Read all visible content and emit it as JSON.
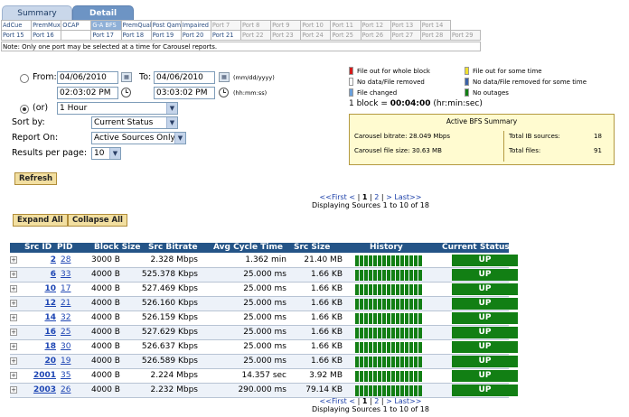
{
  "tabs": [
    {
      "label": "Summary",
      "active": false
    },
    {
      "label": "Detail",
      "active": true
    }
  ],
  "ports": {
    "row1": [
      "AdCue",
      "PremMux1",
      "OCAP",
      "G-A BFS",
      "PremQual",
      "Post Qam",
      "Impaired",
      "Port 7",
      "Port 8",
      "Port 9",
      "Port 10",
      "Port 11",
      "Port 12",
      "Port 13",
      "Port 14"
    ],
    "row2": [
      "Port 15",
      "Port 16",
      "",
      "Port 17",
      "Port 18",
      "Port 19",
      "Port 20",
      "Port 21",
      "Port 22",
      "Port 23",
      "Port 24",
      "Port 25",
      "Port 26",
      "Port 27",
      "Port 28",
      "Port 29"
    ],
    "selected": "G-A BFS",
    "note": "Note: Only one port may be selected at a time for Carousel reports."
  },
  "form": {
    "from_label": "From:",
    "from_date": "04/06/2010",
    "from_time": "02:03:02 PM",
    "to_label": "To:",
    "to_date": "04/06/2010",
    "to_time": "03:03:02 PM",
    "date_format": "(mm/dd/yyyy)",
    "time_format": "(hh:mm:ss)",
    "or_label": "(or)",
    "range_value": "1 Hour",
    "sort_label": "Sort by:",
    "sort_value": "Current Status",
    "report_label": "Report On:",
    "report_value": "Active Sources Only",
    "rpp_label": "Results per page:",
    "rpp_value": "10",
    "refresh_label": "Refresh"
  },
  "legend": {
    "items": [
      {
        "color": "#d61b1b",
        "label": "File out for whole block"
      },
      {
        "color": "#f0e030",
        "label": "File out for some time"
      },
      {
        "color": "#ffffff",
        "label": "No data/File removed"
      },
      {
        "color": "#3a62a8",
        "label": "No data/File removed for some time"
      },
      {
        "color": "#6aa0dc",
        "label": "File changed"
      },
      {
        "color": "#127f14",
        "label": "No outages"
      }
    ],
    "block_prefix": "1 block = ",
    "block_value": "00:04:00",
    "block_suffix": " (hr:min:sec)"
  },
  "summary": {
    "title": "Active BFS Summary",
    "bitrate_label": "Carousel bitrate:",
    "bitrate_value": "28.049 Mbps",
    "filesize_label": "Carousel file size:",
    "filesize_value": "30.63 MB",
    "sources_label": "Total IB sources:",
    "sources_value": "18",
    "files_label": "Total files:",
    "files_value": "91"
  },
  "pagination": {
    "first": "<<First",
    "prev": "<",
    "sep": "|",
    "page1": "1",
    "page2": "2",
    "next": ">",
    "last": "Last>>",
    "info": "Displaying Sources 1 to 10 of 18"
  },
  "buttons": {
    "expand_all": "Expand All",
    "collapse_all": "Collapse All"
  },
  "table": {
    "headers": [
      "Src ID",
      "PID",
      "Block Size",
      "Src Bitrate",
      "Avg Cycle Time",
      "Src Size",
      "History",
      "Current Status"
    ],
    "rows": [
      {
        "src_id": "2",
        "pid": "28",
        "block_size": "3000 B",
        "bitrate": "2.328 Mbps",
        "cycle": "1.362 min",
        "size": "21.40 MB",
        "status": "UP"
      },
      {
        "src_id": "6",
        "pid": "33",
        "block_size": "4000 B",
        "bitrate": "525.378 Kbps",
        "cycle": "25.000 ms",
        "size": "1.66 KB",
        "status": "UP"
      },
      {
        "src_id": "10",
        "pid": "17",
        "block_size": "4000 B",
        "bitrate": "527.469 Kbps",
        "cycle": "25.000 ms",
        "size": "1.66 KB",
        "status": "UP"
      },
      {
        "src_id": "12",
        "pid": "21",
        "block_size": "4000 B",
        "bitrate": "526.160 Kbps",
        "cycle": "25.000 ms",
        "size": "1.66 KB",
        "status": "UP"
      },
      {
        "src_id": "14",
        "pid": "32",
        "block_size": "4000 B",
        "bitrate": "526.159 Kbps",
        "cycle": "25.000 ms",
        "size": "1.66 KB",
        "status": "UP"
      },
      {
        "src_id": "16",
        "pid": "25",
        "block_size": "4000 B",
        "bitrate": "527.629 Kbps",
        "cycle": "25.000 ms",
        "size": "1.66 KB",
        "status": "UP"
      },
      {
        "src_id": "18",
        "pid": "30",
        "block_size": "4000 B",
        "bitrate": "526.637 Kbps",
        "cycle": "25.000 ms",
        "size": "1.66 KB",
        "status": "UP"
      },
      {
        "src_id": "20",
        "pid": "19",
        "block_size": "4000 B",
        "bitrate": "526.589 Kbps",
        "cycle": "25.000 ms",
        "size": "1.66 KB",
        "status": "UP"
      },
      {
        "src_id": "2001",
        "pid": "35",
        "block_size": "4000 B",
        "bitrate": "2.224 Mbps",
        "cycle": "14.357 sec",
        "size": "3.92 MB",
        "status": "UP"
      },
      {
        "src_id": "2003",
        "pid": "26",
        "block_size": "4000 B",
        "bitrate": "2.232 Mbps",
        "cycle": "290.000 ms",
        "size": "79.14 KB",
        "status": "UP"
      }
    ],
    "expander_symbol": "+",
    "history_color": "#127f14",
    "history_blocks": 15
  }
}
